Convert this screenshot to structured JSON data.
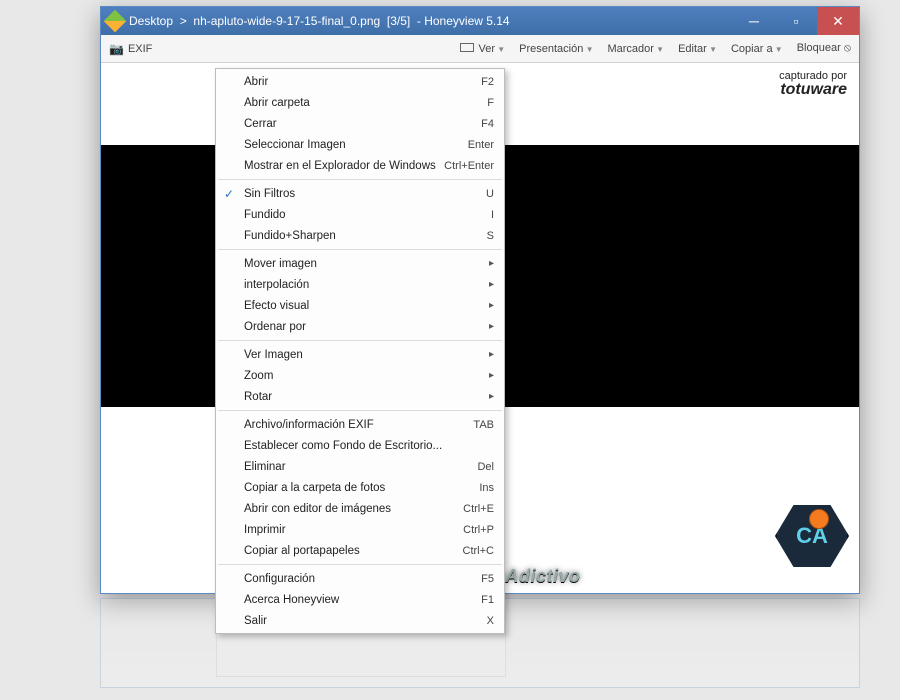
{
  "titlebar": {
    "path_prefix": "Desktop",
    "separator": ">",
    "filename": "nh-apluto-wide-9-17-15-final_0.png",
    "index": "[3/5]",
    "app": "Honeyview 5.14"
  },
  "toolbar": {
    "exif": "EXIF",
    "ver": "Ver",
    "presentacion": "Presentación",
    "marcador": "Marcador",
    "editar": "Editar",
    "copiar": "Copiar a",
    "bloquear": "Bloquear"
  },
  "watermark": {
    "top_line1": "capturado por",
    "top_line2": "totuware",
    "bottom": "ConocimientoAdictivo",
    "badge": "CA"
  },
  "menu": {
    "groups": [
      [
        {
          "label": "Abrir",
          "shortcut": "F2"
        },
        {
          "label": "Abrir carpeta",
          "shortcut": "F"
        },
        {
          "label": "Cerrar",
          "shortcut": "F4"
        },
        {
          "label": "Seleccionar Imagen",
          "shortcut": "Enter"
        },
        {
          "label": "Mostrar en el Explorador de Windows",
          "shortcut": "Ctrl+Enter"
        }
      ],
      [
        {
          "label": "Sin Filtros",
          "shortcut": "U",
          "checked": true
        },
        {
          "label": "Fundido",
          "shortcut": "I"
        },
        {
          "label": "Fundido+Sharpen",
          "shortcut": "S"
        }
      ],
      [
        {
          "label": "Mover imagen",
          "submenu": true
        },
        {
          "label": "interpolación",
          "submenu": true
        },
        {
          "label": "Efecto visual",
          "submenu": true
        },
        {
          "label": "Ordenar por",
          "submenu": true
        }
      ],
      [
        {
          "label": "Ver Imagen",
          "submenu": true
        },
        {
          "label": "Zoom",
          "submenu": true
        },
        {
          "label": "Rotar",
          "submenu": true
        }
      ],
      [
        {
          "label": "Archivo/información EXIF",
          "shortcut": "TAB"
        },
        {
          "label": "Establecer como Fondo de Escritorio..."
        },
        {
          "label": "Eliminar",
          "shortcut": "Del"
        },
        {
          "label": "Copiar a la carpeta de fotos",
          "shortcut": "Ins"
        },
        {
          "label": "Abrir con editor de imágenes",
          "shortcut": "Ctrl+E"
        },
        {
          "label": "Imprimir",
          "shortcut": "Ctrl+P"
        },
        {
          "label": "Copiar al portapapeles",
          "shortcut": "Ctrl+C"
        }
      ],
      [
        {
          "label": "Configuración",
          "shortcut": "F5"
        },
        {
          "label": "Acerca Honeyview",
          "shortcut": "F1"
        },
        {
          "label": "Salir",
          "shortcut": "X"
        }
      ]
    ]
  }
}
